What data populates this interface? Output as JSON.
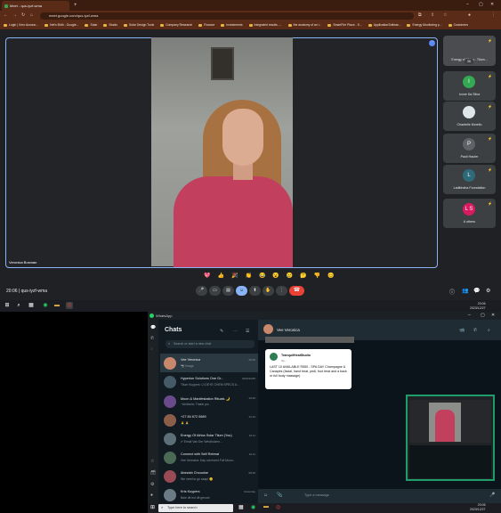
{
  "browser": {
    "tab_title": "Meet - qus-iyzf-wma",
    "new_tab": "+",
    "url": "meet.google.com/qus-iyzf-wma",
    "bookmarks": [
      "Login | Xero Accoun...",
      "Net's Birth - Google...",
      "Solar",
      "Studio",
      "Solar Design Tools",
      "Company Research",
      "Finance",
      "Investments",
      "Integrated results -...",
      "the anatomy of an i...",
      "SmartFire Place - S...",
      "ApplicationSoftwar...",
      "Energy Monitoring p...",
      "Customers"
    ]
  },
  "meet": {
    "speaker_name": "Veronica Bosman",
    "time": "20:06",
    "meeting_code": "qus-iyzf-wma",
    "tiles": [
      {
        "name": "Energy of Africa - Tilum...",
        "initial": "",
        "color": "#5b8af5"
      },
      {
        "name": "Ivone Da Silva",
        "initial": "I",
        "color": "#34a853"
      },
      {
        "name": "Chantelle Morello",
        "initial": "",
        "color": "#dfe6e9"
      },
      {
        "name": "Paoli Hauter",
        "initial": "P",
        "color": "#5f6368"
      },
      {
        "name": "Ladibhaha Foundation",
        "initial": "L",
        "color": "#2d6a7a"
      },
      {
        "name": "6 others",
        "initial": "L S",
        "color": "#d81b60"
      }
    ],
    "extra_count": "36",
    "reactions": [
      "💖",
      "👍",
      "🎉",
      "👏",
      "😂",
      "😮",
      "😢",
      "🤔",
      "👎",
      "😊"
    ],
    "controls": [
      "mic",
      "camera",
      "captions",
      "present",
      "raise-hand",
      "more"
    ]
  },
  "taskbar_top": {
    "time": "20:06",
    "date": "2023/12/27"
  },
  "whatsapp": {
    "window_title": "WhatsApp",
    "chats_title": "Chats",
    "search_placeholder": "Search or start a new chat",
    "chats": [
      {
        "name": "Vee Veronica",
        "preview": "📷 Image",
        "time": "20:06",
        "color": "#c9876b"
      },
      {
        "name": "Hyperion Solutions One Gr...",
        "preview": "Tilum Kuypers: ☑ DEYE CHEM SPECS A...",
        "time": "2023/12/26",
        "color": "#445a66"
      },
      {
        "name": "Moon & Manifestation Rituals 🌙",
        "preview": "~Andiscia: Thank you",
        "time": "19:46",
        "color": "#6a4a8a"
      },
      {
        "name": "+27 84 672 0689",
        "preview": "🙏 🙏",
        "time": "12:12",
        "color": "#8b5e4a"
      },
      {
        "name": "Energy Of Africa Solar Tilum (You)",
        "preview": "✔ Email Van Der Westhuizen...",
        "time": "12:11",
        "color": "#5c6e78"
      },
      {
        "name": "Connect with Self Retreat",
        "preview": "Vee Veronica: Day out event Full Moon...",
        "time": "12:11",
        "color": "#4a6a55"
      },
      {
        "name": "Abeziah Chouoloe",
        "preview": "We need to go asap! 😊",
        "time": "08:26",
        "color": "#9a4a55"
      },
      {
        "name": "Kris Kuypers",
        "preview": "Baie dit hot dit gevoel.",
        "time": "Yesterday",
        "color": "#6b7b85"
      }
    ],
    "conversation": {
      "name": "Vee Veronica",
      "card_title": "TranquilHeatStudio",
      "card_subtitle": "Sp...",
      "message": "LAST 10 AVAILABLE R550 - SPA DAY Champagne & Canapés (facial, hand treat, pedi, foot treat and a back or full body massage)",
      "input_placeholder": "Type a message"
    }
  },
  "taskbar_bottom": {
    "search_placeholder": "Type here to search",
    "time": "20:06",
    "date": "2023/12/27"
  }
}
